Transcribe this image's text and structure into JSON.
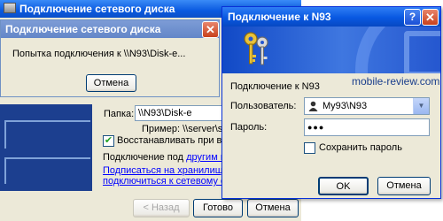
{
  "wizard": {
    "title": "Подключение сетевого диска",
    "folder_label": "Папка:",
    "folder_value": "\\\\N93\\Disk-e",
    "example_label": "Пример: \\\\server\\share",
    "reconnect_label": "Восстанавливать при входе в с",
    "reconnect_checked": true,
    "connect_as_prefix": "Подключение под ",
    "connect_as_link": "другим именем.",
    "link2_line1": "Подписаться на хранилище в Инте",
    "link2_line2": "подключиться к сетевому серверу",
    "back_button": "< Назад",
    "finish_button": "Готово",
    "cancel_button": "Отмена"
  },
  "connecting": {
    "title": "Подключение сетевого диска",
    "message": "Попытка подключения к \\\\N93\\Disk-e...",
    "cancel_button": "Отмена"
  },
  "login": {
    "title": "Подключение к N93",
    "help_button": "?",
    "close_button": "X",
    "connect_label": "Подключение к N93",
    "user_label": "Пользователь:",
    "user_value": "My93\\N93",
    "password_label": "Пароль:",
    "password_value": "●●●",
    "save_password_label": "Сохранить пароль",
    "save_password_checked": false,
    "ok_button": "OK",
    "cancel_button": "Отмена"
  },
  "watermark": "mobile-review.com",
  "colors": {
    "title_active": "#0858e1",
    "title_inactive": "#7d9cd6",
    "window_bg": "#ece9d8",
    "link": "#0000ff"
  }
}
